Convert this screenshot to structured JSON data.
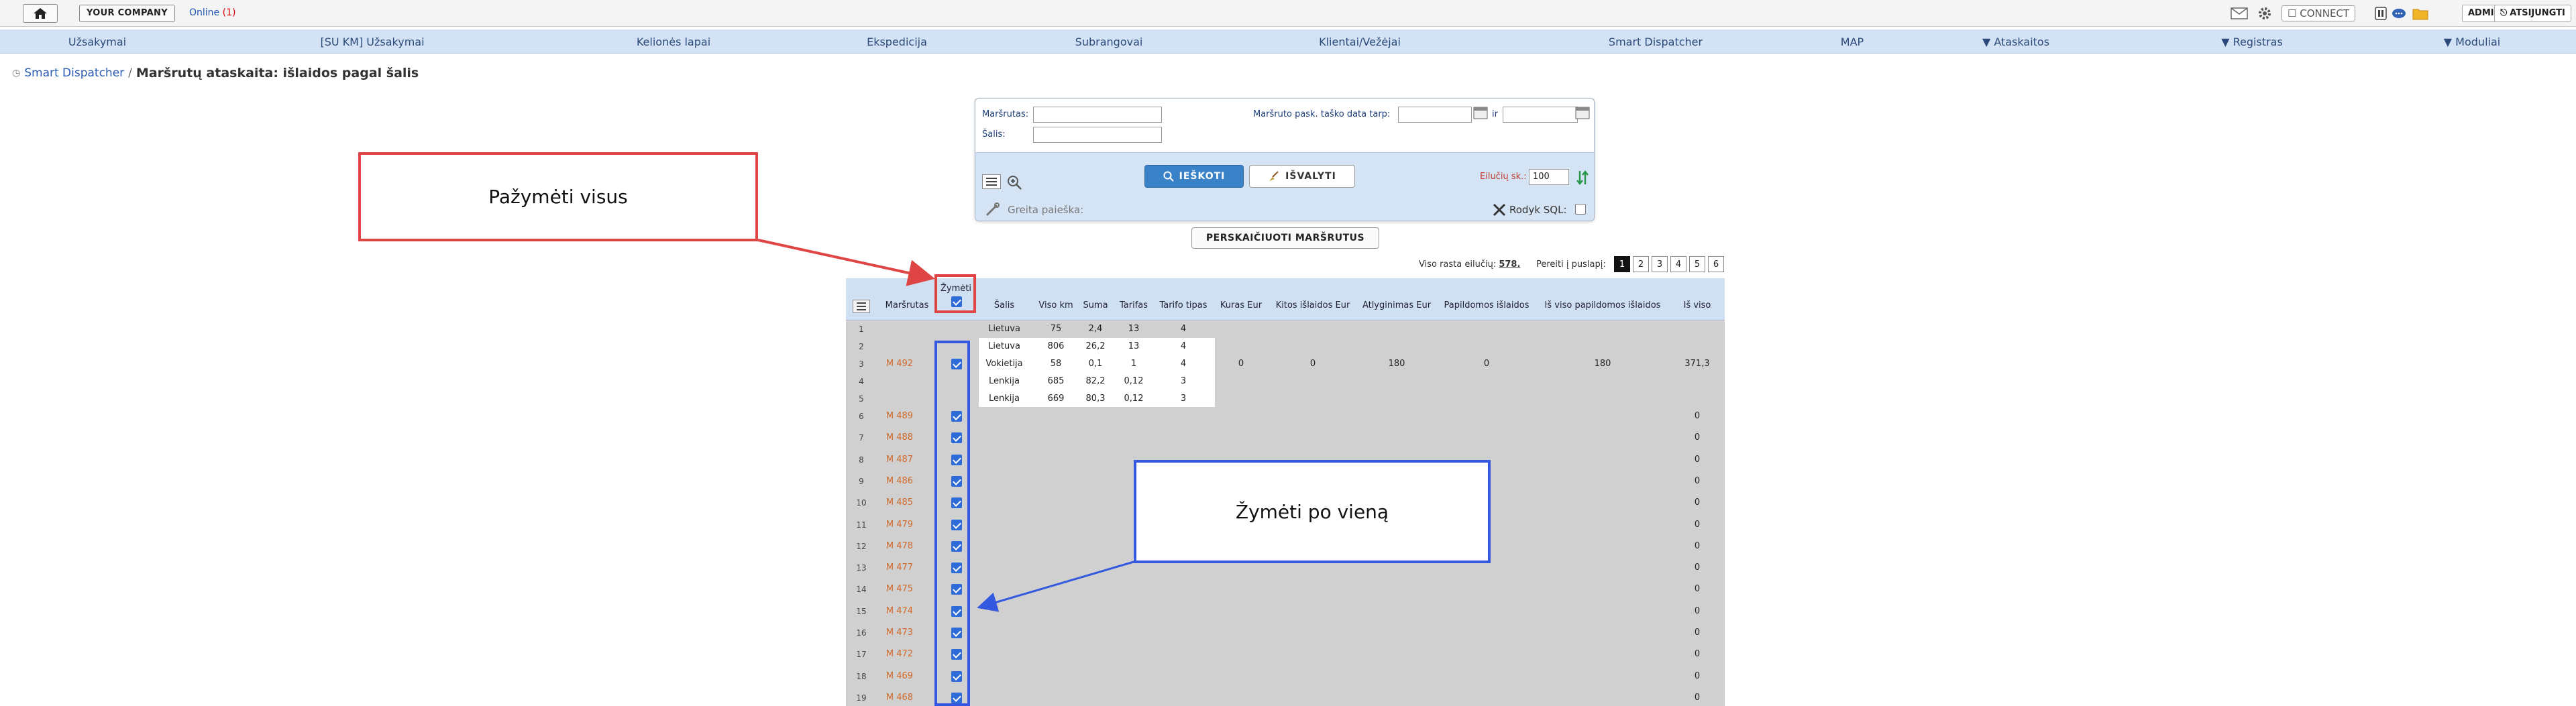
{
  "topbar": {
    "company_label": "YOUR COMPANY",
    "online_label": "Online",
    "online_count": "(1)",
    "connect_label": "CONNECT",
    "admin_label": "ADMIN",
    "logout_label": "ATSIJUNGTI"
  },
  "nav": {
    "items": [
      {
        "label": "Užsakymai"
      },
      {
        "label": "[SU KM] Užsakymai"
      },
      {
        "label": "Kelionės lapai"
      },
      {
        "label": "Ekspedicija"
      },
      {
        "label": "Subrangovai"
      },
      {
        "label": "Klientai/Vežėjai"
      },
      {
        "label": "Smart Dispatcher"
      },
      {
        "label": "MAP"
      },
      {
        "label": "▼ Ataskaitos"
      },
      {
        "label": "▼ Registras"
      },
      {
        "label": "▼ Moduliai"
      }
    ]
  },
  "breadcrumb": {
    "home": "Smart Dispatcher",
    "separator": "/",
    "title": "Maršrutų ataskaita: išlaidos pagal šalis"
  },
  "filter": {
    "route_label": "Maršrutas:",
    "country_label": "Šalis:",
    "date_label": "Maršruto pask. taško data tarp:",
    "and_label": "ir",
    "search_label": "IEŠKOTI",
    "clear_label": "IŠVALYTI",
    "rows_label": "Eilučių sk.:",
    "rows_value": "100",
    "quick_label": "Greita paieška:",
    "sql_label": "Rodyk SQL:"
  },
  "recalc_label": "PERSKAIČIUOTI MARŠRUTUS",
  "summary": {
    "total_label": "Viso rasta eilučių:",
    "total_value": "578.",
    "goto_label": "Pereiti į puslapį:",
    "pages": [
      "1",
      "2",
      "3",
      "4",
      "5",
      "6"
    ]
  },
  "table": {
    "headers": {
      "route": "Maršrutas",
      "mark": "Žymėti",
      "country": "Šalis",
      "total_km": "Viso km",
      "sum": "Suma",
      "tariff": "Tarifas",
      "tariff_type": "Tarifo tipas",
      "fuel": "Kuras Eur",
      "other": "Kitos išlaidos Eur",
      "reward": "Atlyginimas Eur",
      "extra": "Papildomos išlaidos",
      "total_extra": "Iš viso papildomos išlaidos",
      "grand_total": "Iš viso"
    },
    "main_route": {
      "row_no": "3",
      "route": "M 492",
      "fuel": "0",
      "other": "0",
      "reward": "180",
      "extra": "0",
      "total_extra": "180",
      "grand_total": "371,3"
    },
    "detail_rows": [
      {
        "no": "1",
        "country": "Lietuva",
        "km": "75",
        "sum": "2,4",
        "tariff": "13",
        "type": "4"
      },
      {
        "no": "2",
        "country": "Lietuva",
        "km": "806",
        "sum": "26,2",
        "tariff": "13",
        "type": "4"
      },
      {
        "no": "3",
        "country": "Vokietija",
        "km": "58",
        "sum": "0,1",
        "tariff": "1",
        "type": "4"
      },
      {
        "no": "4",
        "country": "Lenkija",
        "km": "685",
        "sum": "82,2",
        "tariff": "0,12",
        "type": "3"
      },
      {
        "no": "5",
        "country": "Lenkija",
        "km": "669",
        "sum": "80,3",
        "tariff": "0,12",
        "type": "3"
      }
    ],
    "route_rows": [
      {
        "no": "6",
        "route": "M 489",
        "total": "0"
      },
      {
        "no": "7",
        "route": "M 488",
        "total": "0"
      },
      {
        "no": "8",
        "route": "M 487",
        "total": "0"
      },
      {
        "no": "9",
        "route": "M 486",
        "total": "0"
      },
      {
        "no": "10",
        "route": "M 485",
        "total": "0"
      },
      {
        "no": "11",
        "route": "M 479",
        "total": "0"
      },
      {
        "no": "12",
        "route": "M 478",
        "total": "0"
      },
      {
        "no": "13",
        "route": "M 477",
        "total": "0"
      },
      {
        "no": "14",
        "route": "M 475",
        "total": "0"
      },
      {
        "no": "15",
        "route": "M 474",
        "total": "0"
      },
      {
        "no": "16",
        "route": "M 473",
        "total": "0"
      },
      {
        "no": "17",
        "route": "M 472",
        "total": "0"
      },
      {
        "no": "18",
        "route": "M 469",
        "total": "0"
      },
      {
        "no": "19",
        "route": "M 468",
        "total": "0"
      }
    ]
  },
  "annotations": {
    "select_all": "Pažymėti visus",
    "select_one": "Žymėti po vieną"
  },
  "colors": {
    "nav_bg": "#d3e3f5",
    "route_link": "#d2692a",
    "annotation_red": "#e04545",
    "annotation_blue": "#3458e0"
  }
}
